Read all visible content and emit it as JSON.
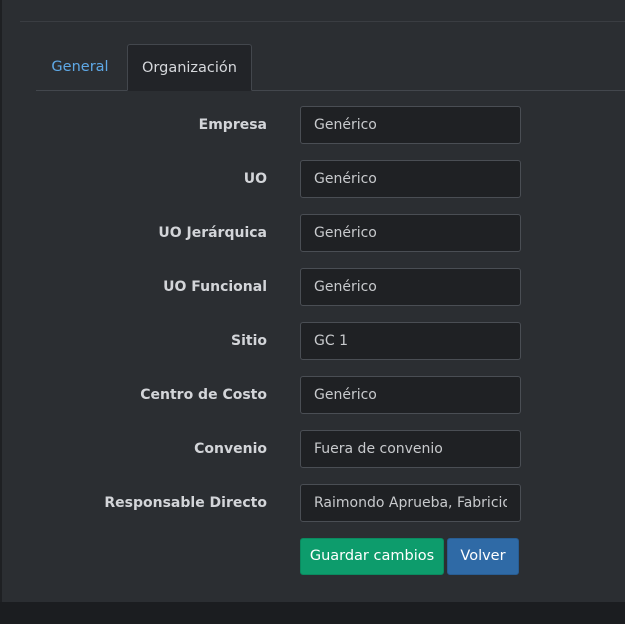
{
  "tabs": [
    {
      "label": "General",
      "active": false
    },
    {
      "label": "Organización",
      "active": true
    }
  ],
  "form": {
    "fields": [
      {
        "label": "Empresa",
        "value": "Genérico"
      },
      {
        "label": "UO",
        "value": "Genérico"
      },
      {
        "label": "UO Jerárquica",
        "value": "Genérico"
      },
      {
        "label": "UO Funcional",
        "value": "Genérico"
      },
      {
        "label": "Sitio",
        "value": "GC 1"
      },
      {
        "label": "Centro de Costo",
        "value": "Genérico"
      },
      {
        "label": "Convenio",
        "value": "Fuera de convenio"
      },
      {
        "label": "Responsable Directo",
        "value": "Raimondo Aprueba, Fabricio"
      }
    ]
  },
  "actions": {
    "save_label": "Guardar cambios",
    "back_label": "Volver"
  },
  "colors": {
    "background": "#2b2e32",
    "tab_link": "#5ea8e6",
    "save_button": "#0d9c6c",
    "back_button": "#2f6aa6"
  }
}
